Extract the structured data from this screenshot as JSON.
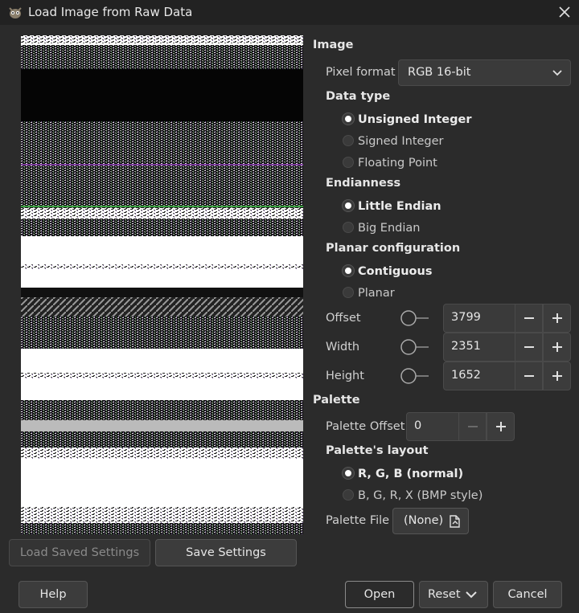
{
  "window": {
    "title": "Load Image from Raw Data",
    "app_icon": "gimp-icon",
    "close_icon": "close-icon"
  },
  "preview": {
    "description_icon": "raw-image-preview"
  },
  "left_buttons": {
    "load_saved": "Load Saved Settings",
    "save": "Save Settings"
  },
  "image_section": {
    "heading": "Image",
    "pixel_format_label": "Pixel format",
    "pixel_format_value": "RGB 16-bit",
    "data_type_heading": "Data type",
    "data_types": [
      "Unsigned Integer",
      "Signed Integer",
      "Floating Point"
    ],
    "data_type_selected": 0,
    "endianness_heading": "Endianness",
    "endianness": [
      "Little Endian",
      "Big Endian"
    ],
    "endianness_selected": 0,
    "planar_heading": "Planar configuration",
    "planar": [
      "Contiguous",
      "Planar"
    ],
    "planar_selected": 0,
    "offset_label": "Offset",
    "offset_value": "3799",
    "width_label": "Width",
    "width_value": "2351",
    "height_label": "Height",
    "height_value": "1652"
  },
  "palette_section": {
    "heading": "Palette",
    "offset_label": "Palette Offset",
    "offset_value": "0",
    "layout_heading": "Palette's layout",
    "layouts": [
      "R, G, B (normal)",
      "B, G, R, X (BMP style)"
    ],
    "layout_selected": 0,
    "file_label": "Palette File",
    "file_value": "(None)"
  },
  "footer": {
    "help": "Help",
    "open": "Open",
    "reset": "Reset",
    "cancel": "Cancel"
  },
  "colors": {
    "background": "#2b2b2b",
    "titlebar": "#222222",
    "field": "#3a3a3a",
    "text": "#d8d8d8"
  }
}
